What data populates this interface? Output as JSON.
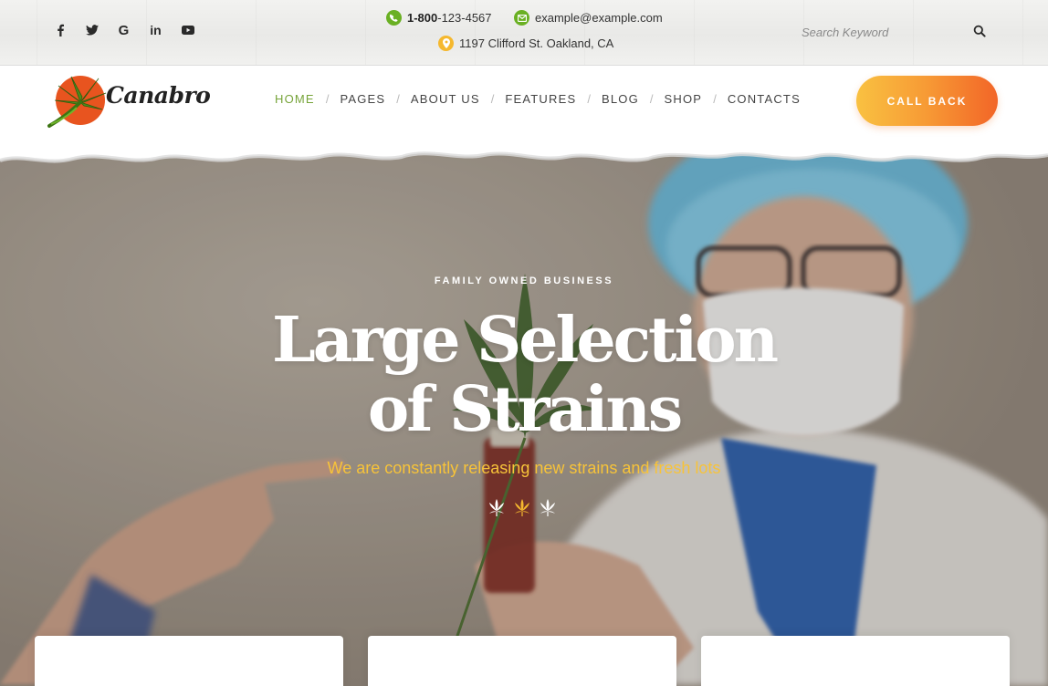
{
  "topbar": {
    "social": [
      {
        "icon": "facebook-icon",
        "glyph": "f"
      },
      {
        "icon": "twitter-icon",
        "glyph": "🐦"
      },
      {
        "icon": "google-icon",
        "glyph": "G"
      },
      {
        "icon": "linkedin-icon",
        "glyph": "in"
      },
      {
        "icon": "youtube-icon",
        "glyph": "▶"
      }
    ],
    "phone_bold": "1-800",
    "phone_rest": "-123-4567",
    "email": "example@example.com",
    "address": "1197 Clifford St. Oakland, CA",
    "search_placeholder": "Search Keyword"
  },
  "header": {
    "logo_text": "Canabro",
    "nav": [
      "HOME",
      "PAGES",
      "ABOUT US",
      "FEATURES",
      "BLOG",
      "SHOP",
      "CONTACTS"
    ],
    "active_nav": "HOME",
    "cta_label": "CALL BACK"
  },
  "hero": {
    "eyebrow": "FAMILY OWNED BUSINESS",
    "headline_line1": "Large Selection",
    "headline_line2": "of Strains",
    "subtitle": "We are constantly releasing new strains and fresh lots",
    "slide_count": 3,
    "active_slide": 2
  },
  "colors": {
    "accent_green": "#77a43a",
    "accent_orange": "#f26527",
    "accent_yellow": "#f7c339",
    "icon_green": "#6ab023",
    "icon_yellow": "#f5b82e"
  }
}
